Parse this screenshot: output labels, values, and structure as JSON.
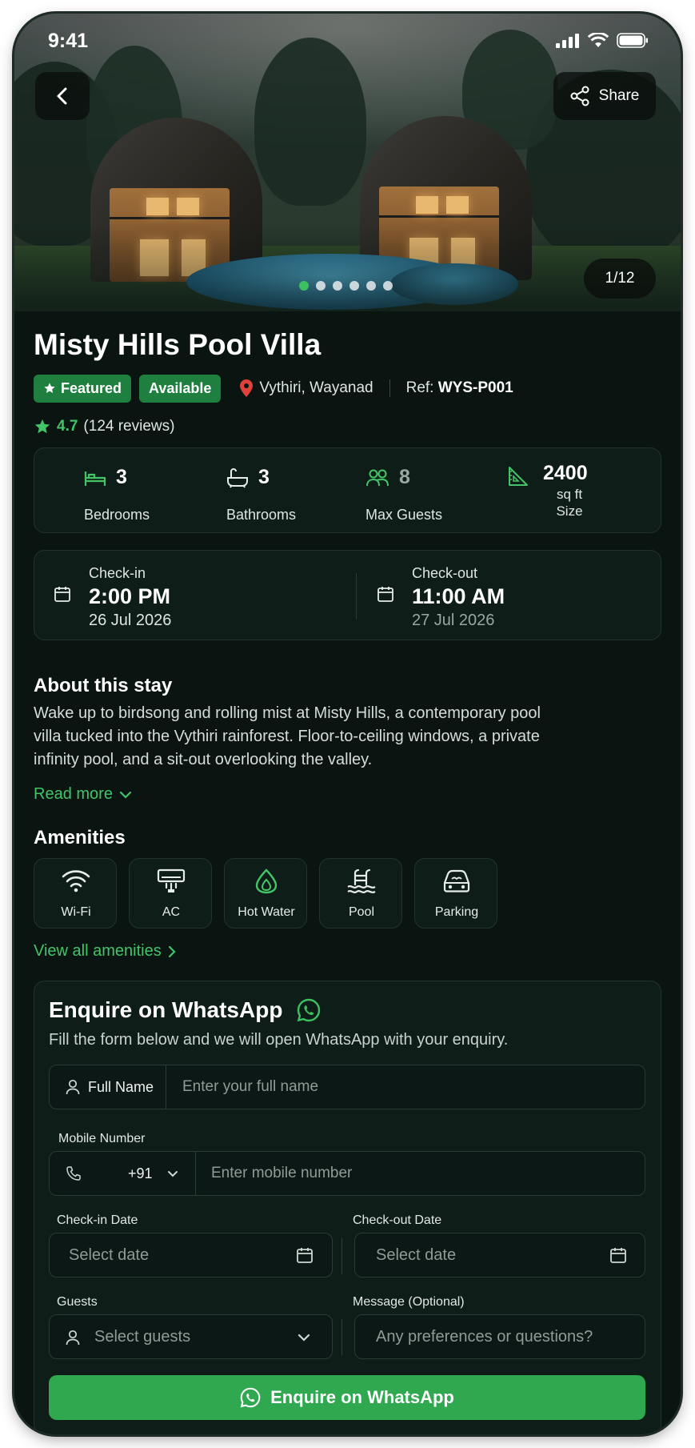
{
  "status_bar": {
    "time": "9:41"
  },
  "gallery": {
    "counter": "1/12",
    "share_label": "Share",
    "dots_count": 6,
    "active_dot": 1
  },
  "listing": {
    "title": "Misty Hills Pool Villa",
    "badges": {
      "featured": "Featured",
      "available": "Available"
    },
    "location": "Vythiri, Wayanad",
    "ref_label": "Ref:",
    "ref_code": "WYS-P001",
    "rating": "4.7",
    "reviews": "(124 reviews)"
  },
  "stats": {
    "bedrooms": {
      "value": "3",
      "label": "Bedrooms"
    },
    "bathrooms": {
      "value": "3",
      "label": "Bathrooms"
    },
    "guests": {
      "value": "8",
      "label": "Max Guests"
    },
    "size": {
      "value": "2400",
      "unit": "sq ft",
      "label": "Size"
    }
  },
  "stay": {
    "checkin": {
      "label": "Check-in",
      "time": "2:00 PM",
      "date": "26 Jul 2026"
    },
    "checkout": {
      "label": "Check-out",
      "time": "11:00 AM",
      "date": "27 Jul 2026"
    }
  },
  "about": {
    "heading": "About this stay",
    "text": "Wake up to birdsong and rolling mist at Misty Hills, a contemporary pool villa tucked into the Vythiri rainforest. Floor-to-ceiling windows, a private infinity pool, and a sit-out overlooking the valley.",
    "read_more": "Read more"
  },
  "amenities": {
    "heading": "Amenities",
    "items": [
      "Wi-Fi",
      "AC",
      "Hot Water",
      "Pool",
      "Parking"
    ],
    "view_all": "View all amenities"
  },
  "form": {
    "title": "Enquire on WhatsApp",
    "subtitle": "Fill the form below and we will open WhatsApp with your enquiry.",
    "name_label": "Full Name",
    "name_placeholder": "Enter your full name",
    "mobile_label": "Mobile Number",
    "country_code": "+91",
    "mobile_placeholder": "Enter mobile number",
    "checkin_label": "Check-in Date",
    "checkout_label": "Check-out Date",
    "date_placeholder": "Select date",
    "guests_label": "Guests",
    "guests_placeholder": "Select guests",
    "message_label": "Message (Optional)",
    "message_placeholder": "Any preferences or questions?",
    "submit": "Enquire on WhatsApp"
  },
  "colors": {
    "accent": "#43c467",
    "cta": "#2fa84f",
    "background": "#0a1512",
    "card": "#0f1d19",
    "badge": "#1f7f3f"
  }
}
